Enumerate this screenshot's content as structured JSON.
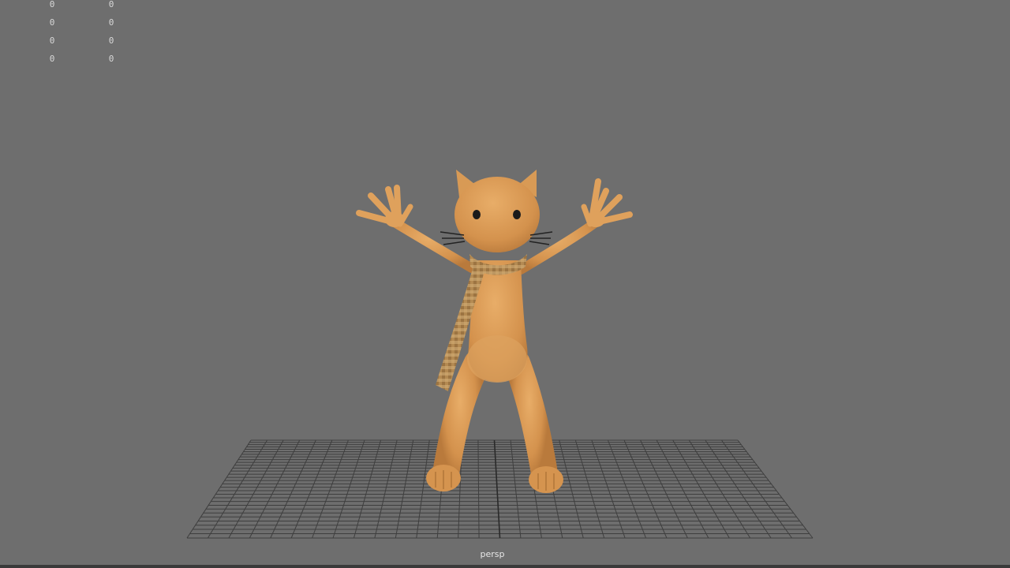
{
  "viewport": {
    "background_color": "#6e6e6e",
    "camera_label": "persp",
    "hud": {
      "column_1": [
        "0",
        "0",
        "0",
        "0"
      ],
      "column_2": [
        "0",
        "0",
        "0",
        "0"
      ]
    }
  },
  "scene": {
    "character": "cartoon-cat",
    "skin_color": "#d99a55",
    "scarf_pattern": "plaid",
    "grid_color": "#3e3e3e"
  }
}
